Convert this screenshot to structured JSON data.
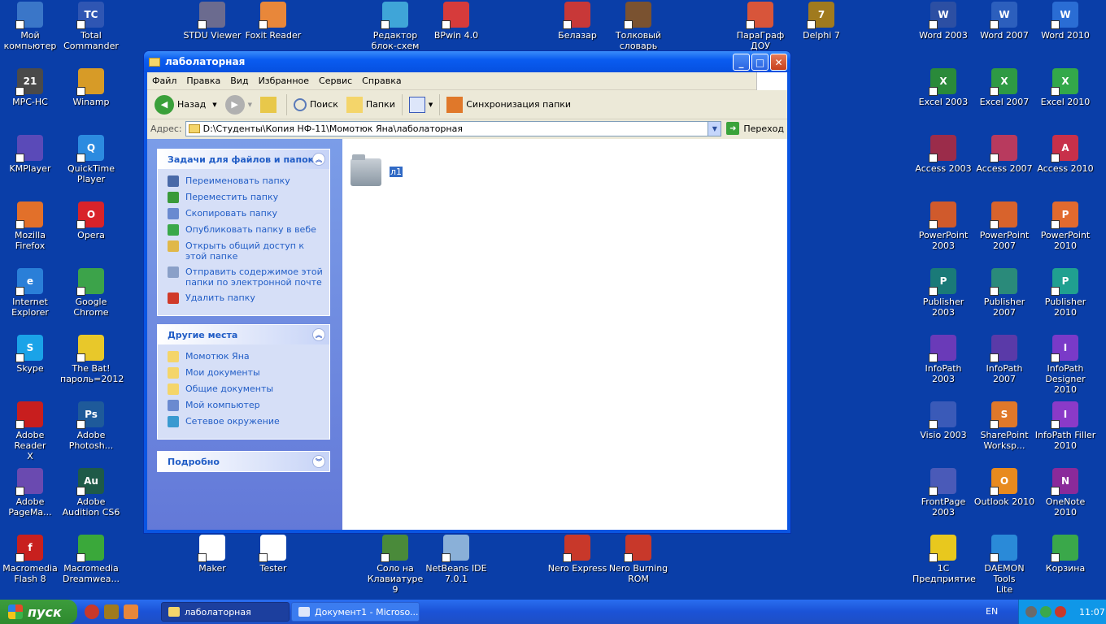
{
  "desktop": {
    "icons": [
      {
        "label": "Мой\nкомпьютер",
        "color": "#3a76c8",
        "glyph": "",
        "icon": "computer-icon"
      },
      {
        "label": "Total\nCommander",
        "color": "#2f56b3",
        "glyph": "TC",
        "icon": "floppy-icon"
      },
      {
        "label": "STDU Viewer",
        "color": "#6b6b8f",
        "glyph": "",
        "icon": "magnifier-icon"
      },
      {
        "label": "Foxit Reader",
        "color": "#e8873a",
        "glyph": "",
        "icon": "foxit-icon"
      },
      {
        "label": "Редактор\nблок-схем",
        "color": "#3fa5d8",
        "glyph": "",
        "icon": "flowchart-icon"
      },
      {
        "label": "BPwin 4.0",
        "color": "#d63b3b",
        "glyph": "",
        "icon": "bpwin-icon"
      },
      {
        "label": "Белазар",
        "color": "#c83838",
        "glyph": "",
        "icon": "belazar-icon"
      },
      {
        "label": "Толковый\nсловарь",
        "color": "#7a5230",
        "glyph": "",
        "icon": "owl-icon"
      },
      {
        "label": "ПараГраф\nДОУ",
        "color": "#d8553a",
        "glyph": "",
        "icon": "paragraf-icon"
      },
      {
        "label": "Delphi 7",
        "color": "#a07a1e",
        "glyph": "7",
        "icon": "delphi-icon"
      },
      {
        "label": "Word 2003",
        "color": "#2c4fa3",
        "glyph": "W",
        "icon": "word-icon"
      },
      {
        "label": "Word 2007",
        "color": "#2c5fbd",
        "glyph": "W",
        "icon": "word-icon"
      },
      {
        "label": "Word 2010",
        "color": "#2a6dd4",
        "glyph": "W",
        "icon": "word-icon"
      },
      {
        "label": "MPC-HC",
        "color": "#4a4a4a",
        "glyph": "21",
        "icon": "media-player-icon"
      },
      {
        "label": "Winamp",
        "color": "#d79b27",
        "glyph": "",
        "icon": "winamp-icon"
      },
      {
        "label": "Excel 2003",
        "color": "#2a8a3a",
        "glyph": "X",
        "icon": "excel-icon"
      },
      {
        "label": "Excel 2007",
        "color": "#2e9a44",
        "glyph": "X",
        "icon": "excel-icon"
      },
      {
        "label": "Excel 2010",
        "color": "#33a84a",
        "glyph": "X",
        "icon": "excel-icon"
      },
      {
        "label": "KMPlayer",
        "color": "#5a4ab8",
        "glyph": "",
        "icon": "kmplayer-icon"
      },
      {
        "label": "QuickTime\nPlayer",
        "color": "#2c8be0",
        "glyph": "Q",
        "icon": "quicktime-icon"
      },
      {
        "label": "Access 2003",
        "color": "#9b2c4a",
        "glyph": "",
        "icon": "access-icon"
      },
      {
        "label": "Access 2007",
        "color": "#b83a5e",
        "glyph": "",
        "icon": "access-icon"
      },
      {
        "label": "Access 2010",
        "color": "#c8304a",
        "glyph": "A",
        "icon": "access-icon"
      },
      {
        "label": "Mozilla Firefox",
        "color": "#e2702a",
        "glyph": "",
        "icon": "firefox-icon"
      },
      {
        "label": "Opera",
        "color": "#d8232a",
        "glyph": "O",
        "icon": "opera-icon"
      },
      {
        "label": "PowerPoint\n2003",
        "color": "#d05a2c",
        "glyph": "",
        "icon": "powerpoint-icon"
      },
      {
        "label": "PowerPoint\n2007",
        "color": "#d8632c",
        "glyph": "",
        "icon": "powerpoint-icon"
      },
      {
        "label": "PowerPoint\n2010",
        "color": "#e26a2e",
        "glyph": "P",
        "icon": "powerpoint-icon"
      },
      {
        "label": "Internet\nExplorer",
        "color": "#2a7fd8",
        "glyph": "e",
        "icon": "ie-icon"
      },
      {
        "label": "Google\nChrome",
        "color": "#3ca34a",
        "glyph": "",
        "icon": "chrome-icon"
      },
      {
        "label": "Publisher 2003",
        "color": "#1a7a78",
        "glyph": "P",
        "icon": "publisher-icon"
      },
      {
        "label": "Publisher 2007",
        "color": "#2a8a7a",
        "glyph": "",
        "icon": "publisher-icon"
      },
      {
        "label": "Publisher 2010",
        "color": "#20a090",
        "glyph": "P",
        "icon": "publisher-icon"
      },
      {
        "label": "Skype",
        "color": "#1aa3e8",
        "glyph": "S",
        "icon": "skype-icon"
      },
      {
        "label": "The Bat!\nпароль=2012",
        "color": "#e8c82a",
        "glyph": "",
        "icon": "thebat-icon"
      },
      {
        "label": "InfoPath 2003",
        "color": "#6a3ab8",
        "glyph": "",
        "icon": "infopath-icon"
      },
      {
        "label": "InfoPath 2007",
        "color": "#5a3aa8",
        "glyph": "",
        "icon": "infopath-icon"
      },
      {
        "label": "InfoPath\nDesigner 2010",
        "color": "#7a3ac8",
        "glyph": "I",
        "icon": "infopath-icon"
      },
      {
        "label": "Adobe Reader\nX",
        "color": "#c81e1e",
        "glyph": "",
        "icon": "adobe-reader-icon"
      },
      {
        "label": "Adobe\nPhotosh...",
        "color": "#1e5a9a",
        "glyph": "Ps",
        "icon": "photoshop-icon"
      },
      {
        "label": "Visio 2003",
        "color": "#3a5ab8",
        "glyph": "",
        "icon": "visio-icon"
      },
      {
        "label": "SharePoint\nWorksp...",
        "color": "#e0782a",
        "glyph": "S",
        "icon": "sharepoint-icon"
      },
      {
        "label": "InfoPath Filler\n2010",
        "color": "#8a3ac8",
        "glyph": "I",
        "icon": "infopath-icon"
      },
      {
        "label": "Adobe\nPageMa...",
        "color": "#6a4ab0",
        "glyph": "",
        "icon": "pagemaker-icon"
      },
      {
        "label": "Adobe\nAudition CS6",
        "color": "#1e5a48",
        "glyph": "Au",
        "icon": "audition-icon"
      },
      {
        "label": "FrontPage\n2003",
        "color": "#4a5ab8",
        "glyph": "",
        "icon": "frontpage-icon"
      },
      {
        "label": "Outlook 2010",
        "color": "#e88a1e",
        "glyph": "O",
        "icon": "outlook-icon"
      },
      {
        "label": "OneNote 2010",
        "color": "#8a2a9a",
        "glyph": "N",
        "icon": "onenote-icon"
      },
      {
        "label": "Macromedia\nFlash 8",
        "color": "#c8201e",
        "glyph": "f",
        "icon": "flash-icon"
      },
      {
        "label": "Macromedia\nDreamwea...",
        "color": "#3aa83a",
        "glyph": "",
        "icon": "dreamweaver-icon"
      },
      {
        "label": "Maker",
        "color": "#ffffff",
        "glyph": "",
        "icon": "maker-icon"
      },
      {
        "label": "Tester",
        "color": "#ffffff",
        "glyph": "",
        "icon": "tester-icon"
      },
      {
        "label": "Соло на\nКлавиатуре 9",
        "color": "#4a8a3a",
        "glyph": "",
        "icon": "solo-icon"
      },
      {
        "label": "NetBeans IDE\n7.0.1",
        "color": "#8ab0d8",
        "glyph": "",
        "icon": "netbeans-icon"
      },
      {
        "label": "Nero Express",
        "color": "#c8382a",
        "glyph": "",
        "icon": "nero-icon"
      },
      {
        "label": "Nero Burning\nROM",
        "color": "#c8382a",
        "glyph": "",
        "icon": "nero-icon"
      },
      {
        "label": "1C\nПредприятие",
        "color": "#e8c81e",
        "glyph": "",
        "icon": "1c-icon"
      },
      {
        "label": "DAEMON Tools\nLite",
        "color": "#2a8ad8",
        "glyph": "",
        "icon": "daemon-tools-icon"
      },
      {
        "label": "Корзина",
        "color": "#3aa84a",
        "glyph": "",
        "icon": "recycle-bin-icon"
      }
    ]
  },
  "window": {
    "title": "лаболаторная",
    "menu": [
      "Файл",
      "Правка",
      "Вид",
      "Избранное",
      "Сервис",
      "Справка"
    ],
    "toolbar": {
      "back": "Назад",
      "search": "Поиск",
      "folders": "Папки",
      "sync": "Синхронизация папки"
    },
    "address": {
      "label": "Адрес:",
      "value": "D:\\Студенты\\Копия НФ-11\\Момотюк Яна\\лаболаторная",
      "go": "Переход"
    },
    "tasks": {
      "title": "Задачи для файлов и папок",
      "items": [
        {
          "label": "Переименовать папку",
          "color": "#4a6aa8"
        },
        {
          "label": "Переместить папку",
          "color": "#3a9a3a"
        },
        {
          "label": "Скопировать папку",
          "color": "#6a8ad0"
        },
        {
          "label": "Опубликовать папку в вебе",
          "color": "#3aa84a"
        },
        {
          "label": "Открыть общий доступ к этой папке",
          "color": "#e0b84a"
        },
        {
          "label": "Отправить содержимое этой папки по электронной почте",
          "color": "#8aa0c8"
        },
        {
          "label": "Удалить папку",
          "color": "#d03a2a"
        }
      ]
    },
    "places": {
      "title": "Другие места",
      "items": [
        {
          "label": "Момотюк Яна",
          "color": "#f4d56a"
        },
        {
          "label": "Мои документы",
          "color": "#f4d56a"
        },
        {
          "label": "Общие документы",
          "color": "#f4d56a"
        },
        {
          "label": "Мой компьютер",
          "color": "#6a8ad0"
        },
        {
          "label": "Сетевое окружение",
          "color": "#3a9ad0"
        }
      ]
    },
    "details": {
      "title": "Подробно"
    },
    "files": [
      {
        "name": "л1",
        "selected": true
      }
    ]
  },
  "taskbar": {
    "start": "пуск",
    "buttons": [
      {
        "label": "лаболаторная",
        "active": true
      },
      {
        "label": "Документ1 - Microso...",
        "active": false
      }
    ],
    "language": "EN",
    "time": "11:07"
  }
}
